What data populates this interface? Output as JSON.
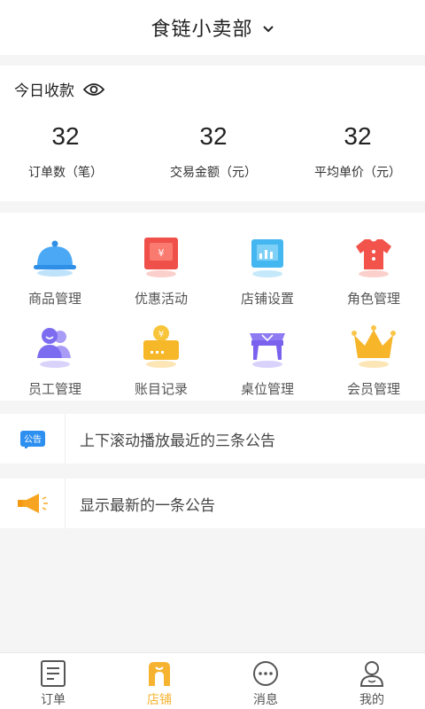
{
  "header": {
    "title": "食链小卖部",
    "dropdown_icon": "chevron-down-icon"
  },
  "income": {
    "label": "今日收款",
    "eye_icon": "eye-icon",
    "stats": [
      {
        "value": "32",
        "caption": "订单数（笔）"
      },
      {
        "value": "32",
        "caption": "交易金额（元）"
      },
      {
        "value": "32",
        "caption": "平均单价（元）"
      }
    ]
  },
  "menu": [
    {
      "label": "商品管理",
      "icon": "product-cloche-icon",
      "color": "#4aa8f5"
    },
    {
      "label": "优惠活动",
      "icon": "discount-coupon-icon",
      "color": "#f0504a"
    },
    {
      "label": "店铺设置",
      "icon": "store-settings-icon",
      "color": "#44b6f0"
    },
    {
      "label": "角色管理",
      "icon": "role-shirt-icon",
      "color": "#f2534b"
    },
    {
      "label": "员工管理",
      "icon": "staff-people-icon",
      "color": "#7b6cf0"
    },
    {
      "label": "账目记录",
      "icon": "account-wallet-icon",
      "color": "#f6b728"
    },
    {
      "label": "桌位管理",
      "icon": "table-icon",
      "color": "#7a62ee"
    },
    {
      "label": "会员管理",
      "icon": "member-crown-icon",
      "color": "#f7b52a"
    }
  ],
  "notices": [
    {
      "badge": "公告",
      "text": "上下滚动播放最近的三条公告",
      "icon": "notice-badge-icon"
    },
    {
      "text": "显示最新的一条公告",
      "icon": "megaphone-icon"
    }
  ],
  "tabbar": [
    {
      "label": "订单",
      "icon": "order-list-icon"
    },
    {
      "label": "店铺",
      "icon": "store-icon",
      "active": true
    },
    {
      "label": "消息",
      "icon": "message-bubble-icon"
    },
    {
      "label": "我的",
      "icon": "user-profile-icon"
    }
  ],
  "colors": {
    "accent": "#f6b330",
    "background": "#f5f5f5"
  }
}
